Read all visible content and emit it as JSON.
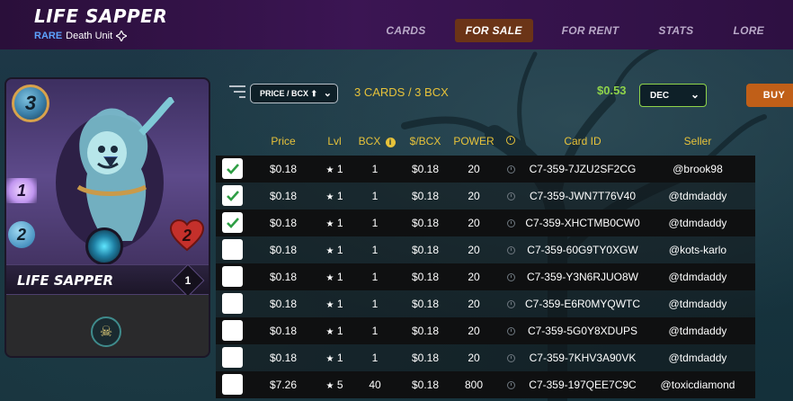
{
  "header": {
    "title": "LIFE SAPPER",
    "rarity": "RARE",
    "unit_type": "Death Unit",
    "nav": [
      {
        "label": "CARDS",
        "active": false
      },
      {
        "label": "FOR SALE",
        "active": true
      },
      {
        "label": "FOR RENT",
        "active": false
      },
      {
        "label": "STATS",
        "active": false
      },
      {
        "label": "LORE",
        "active": false
      }
    ]
  },
  "card": {
    "name": "LIFE SAPPER",
    "mana": "3",
    "attack": "1",
    "speed": "2",
    "health": "2",
    "level": "1"
  },
  "toolbar": {
    "sort_label": "PRICE / BCX ⬆",
    "count_label": "3 CARDS / 3 BCX",
    "total_price": "$0.53",
    "currency": "DEC",
    "buy_label": "BUY"
  },
  "table": {
    "headers": {
      "price": "Price",
      "lvl": "Lvl",
      "bcx": "BCX",
      "per_bcx": "$/BCX",
      "power": "POWER",
      "card_id": "Card ID",
      "seller": "Seller"
    },
    "rows": [
      {
        "checked": true,
        "price": "$0.18",
        "lvl": "1",
        "bcx": "1",
        "per_bcx": "$0.18",
        "power": "20",
        "card_id": "C7-359-7JZU2SF2CG",
        "seller": "@brook98"
      },
      {
        "checked": true,
        "price": "$0.18",
        "lvl": "1",
        "bcx": "1",
        "per_bcx": "$0.18",
        "power": "20",
        "card_id": "C7-359-JWN7T76V40",
        "seller": "@tdmdaddy"
      },
      {
        "checked": true,
        "price": "$0.18",
        "lvl": "1",
        "bcx": "1",
        "per_bcx": "$0.18",
        "power": "20",
        "card_id": "C7-359-XHCTMB0CW0",
        "seller": "@tdmdaddy"
      },
      {
        "checked": false,
        "price": "$0.18",
        "lvl": "1",
        "bcx": "1",
        "per_bcx": "$0.18",
        "power": "20",
        "card_id": "C7-359-60G9TY0XGW",
        "seller": "@kots-karlo"
      },
      {
        "checked": false,
        "price": "$0.18",
        "lvl": "1",
        "bcx": "1",
        "per_bcx": "$0.18",
        "power": "20",
        "card_id": "C7-359-Y3N6RJUO8W",
        "seller": "@tdmdaddy"
      },
      {
        "checked": false,
        "price": "$0.18",
        "lvl": "1",
        "bcx": "1",
        "per_bcx": "$0.18",
        "power": "20",
        "card_id": "C7-359-E6R0MYQWTC",
        "seller": "@tdmdaddy"
      },
      {
        "checked": false,
        "price": "$0.18",
        "lvl": "1",
        "bcx": "1",
        "per_bcx": "$0.18",
        "power": "20",
        "card_id": "C7-359-5G0Y8XDUPS",
        "seller": "@tdmdaddy"
      },
      {
        "checked": false,
        "price": "$0.18",
        "lvl": "1",
        "bcx": "1",
        "per_bcx": "$0.18",
        "power": "20",
        "card_id": "C7-359-7KHV3A90VK",
        "seller": "@tdmdaddy"
      },
      {
        "checked": false,
        "price": "$7.26",
        "lvl": "5",
        "bcx": "40",
        "per_bcx": "$0.18",
        "power": "800",
        "card_id": "C7-359-197QEE7C9C",
        "seller": "@toxicdiamond"
      }
    ]
  },
  "colors": {
    "accent_yellow": "#e7c23a",
    "price_green": "#8fd44a",
    "buy_orange": "#c05f18",
    "header_purple": "#3b1553"
  }
}
